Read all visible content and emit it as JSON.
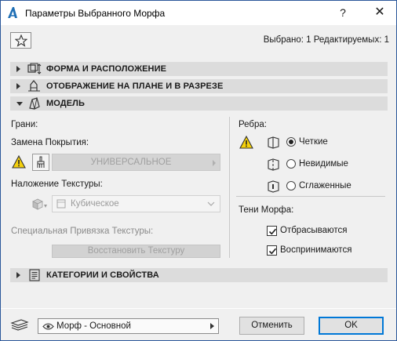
{
  "window": {
    "title": "Параметры Выбранного Морфа",
    "help_glyph": "?",
    "close_glyph": "✕"
  },
  "header": {
    "selection_info": "Выбрано: 1 Редактируемых: 1"
  },
  "sections": [
    {
      "label": "ФОРМА И РАСПОЛОЖЕНИЕ",
      "expanded": false
    },
    {
      "label": "ОТОБРАЖЕНИЕ НА ПЛАНЕ И В РАЗРЕЗЕ",
      "expanded": false
    },
    {
      "label": "МОДЕЛЬ",
      "expanded": true
    },
    {
      "label": "КАТЕГОРИИ И СВОЙСТВА",
      "expanded": false
    }
  ],
  "model": {
    "faces_label": "Грани:",
    "surface_override_label": "Замена Покрытия:",
    "surface_value": "УНИВЕРСАЛЬНОЕ",
    "texture_mapping_label": "Наложение Текстуры:",
    "texture_mapping_value": "Кубическое",
    "special_texture_label": "Специальная Привязка Текстуры:",
    "restore_texture_button": "Восстановить Текстуру",
    "edges_label": "Ребра:",
    "edge_options": [
      "Четкие",
      "Невидимые",
      "Сглаженные"
    ],
    "edge_selected": "Четкие",
    "shadows_label": "Тени Морфа:",
    "shadow_options": [
      {
        "label": "Отбрасываются",
        "checked": true
      },
      {
        "label": "Воспринимаются",
        "checked": true
      }
    ]
  },
  "footer": {
    "view_value": "Морф - Основной",
    "cancel_label": "Отменить",
    "ok_label": "OK"
  },
  "colors": {
    "dialog_bg": "#f0f0f0",
    "section_bg": "#dcdcdc",
    "accent": "#0078d7",
    "warning": "#f5d10c"
  }
}
